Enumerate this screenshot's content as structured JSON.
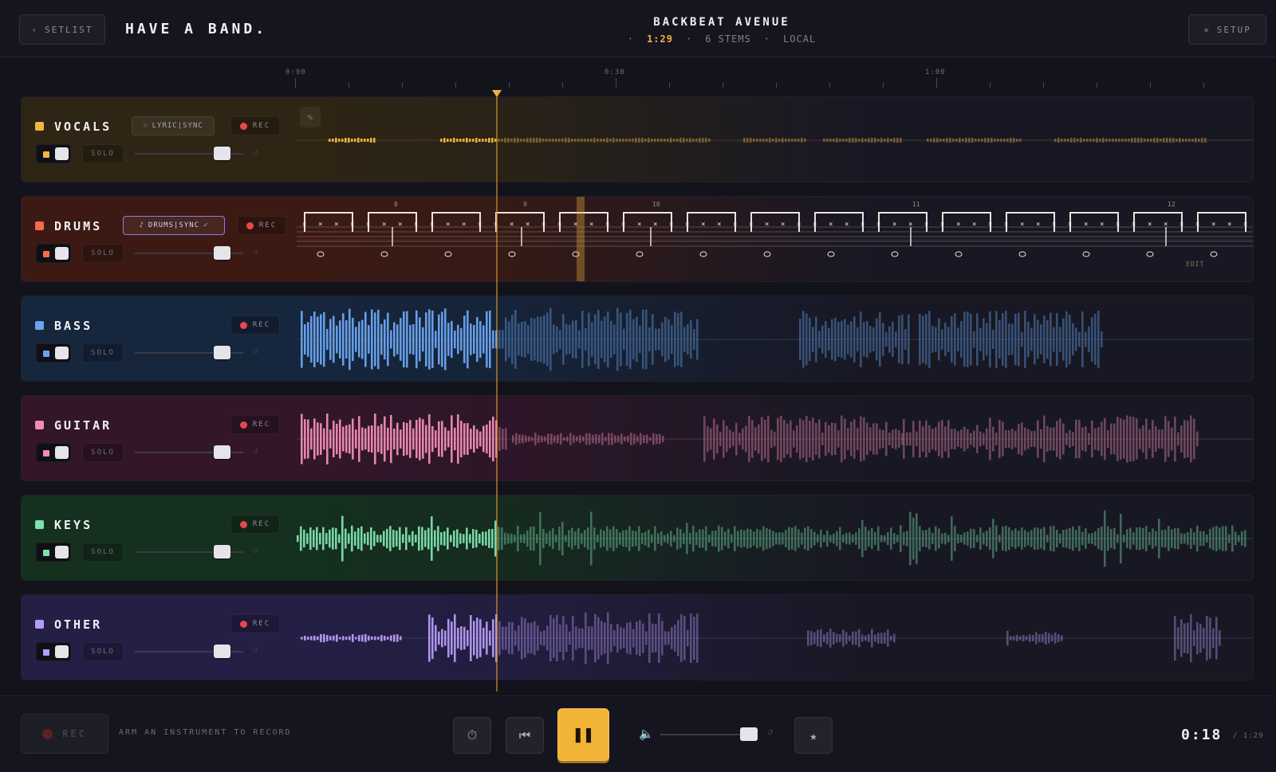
{
  "header": {
    "back_label": "SETLIST",
    "brand": "HAVE A BAND.",
    "song_title": "BACKBEAT AVENUE",
    "song_length": "1:29",
    "stems": "6 STEMS",
    "source": "LOCAL",
    "sep": "·",
    "setup_label": "SETUP"
  },
  "timeline": {
    "labels": [
      "0:00",
      "0:30",
      "1:00"
    ],
    "playhead_time": "0:18"
  },
  "tracks": [
    {
      "name": "VOCALS",
      "color": "#f0b545",
      "bg": "#2e2514",
      "rec_label": "REC",
      "solo_label": "SOLO",
      "sync_label": "LYRIC|SYNC",
      "volume": 0.8,
      "muted_on": true
    },
    {
      "name": "DRUMS",
      "color": "#f26b4f",
      "bg": "#3c1a13",
      "rec_label": "REC",
      "solo_label": "SOLO",
      "sync_label": "DRUMS|SYNC",
      "sync_check": "✓",
      "edit_label": "EDIT",
      "measures": [
        "8",
        "9",
        "10",
        "11",
        "12"
      ],
      "volume": 0.8
    },
    {
      "name": "BASS",
      "color": "#6aa4f0",
      "bg": "#16263d",
      "rec_label": "REC",
      "solo_label": "SOLO",
      "volume": 0.8
    },
    {
      "name": "GUITAR",
      "color": "#f08cb6",
      "bg": "#33162a",
      "rec_label": "REC",
      "solo_label": "SOLO",
      "volume": 0.8
    },
    {
      "name": "KEYS",
      "color": "#7ee0ad",
      "bg": "#15301f",
      "rec_label": "REC",
      "solo_label": "SOLO",
      "volume": 0.8
    },
    {
      "name": "OTHER",
      "color": "#b69bf6",
      "bg": "#251f46",
      "rec_label": "REC",
      "solo_label": "SOLO",
      "volume": 0.8
    }
  ],
  "footer": {
    "rec_label": "REC",
    "arm_hint": "ARM AN INSTRUMENT TO RECORD",
    "time_now": "0:18",
    "time_total": "/ 1:29",
    "master_volume": 0.8
  },
  "icons": {
    "back": "chevron-left-icon",
    "setup": "gear-icon",
    "metronome": "stopwatch-icon",
    "restart": "skip-back-icon",
    "pause": "pause-icon",
    "speaker": "speaker-icon",
    "favorite": "star-icon",
    "edit": "pencil-icon"
  }
}
